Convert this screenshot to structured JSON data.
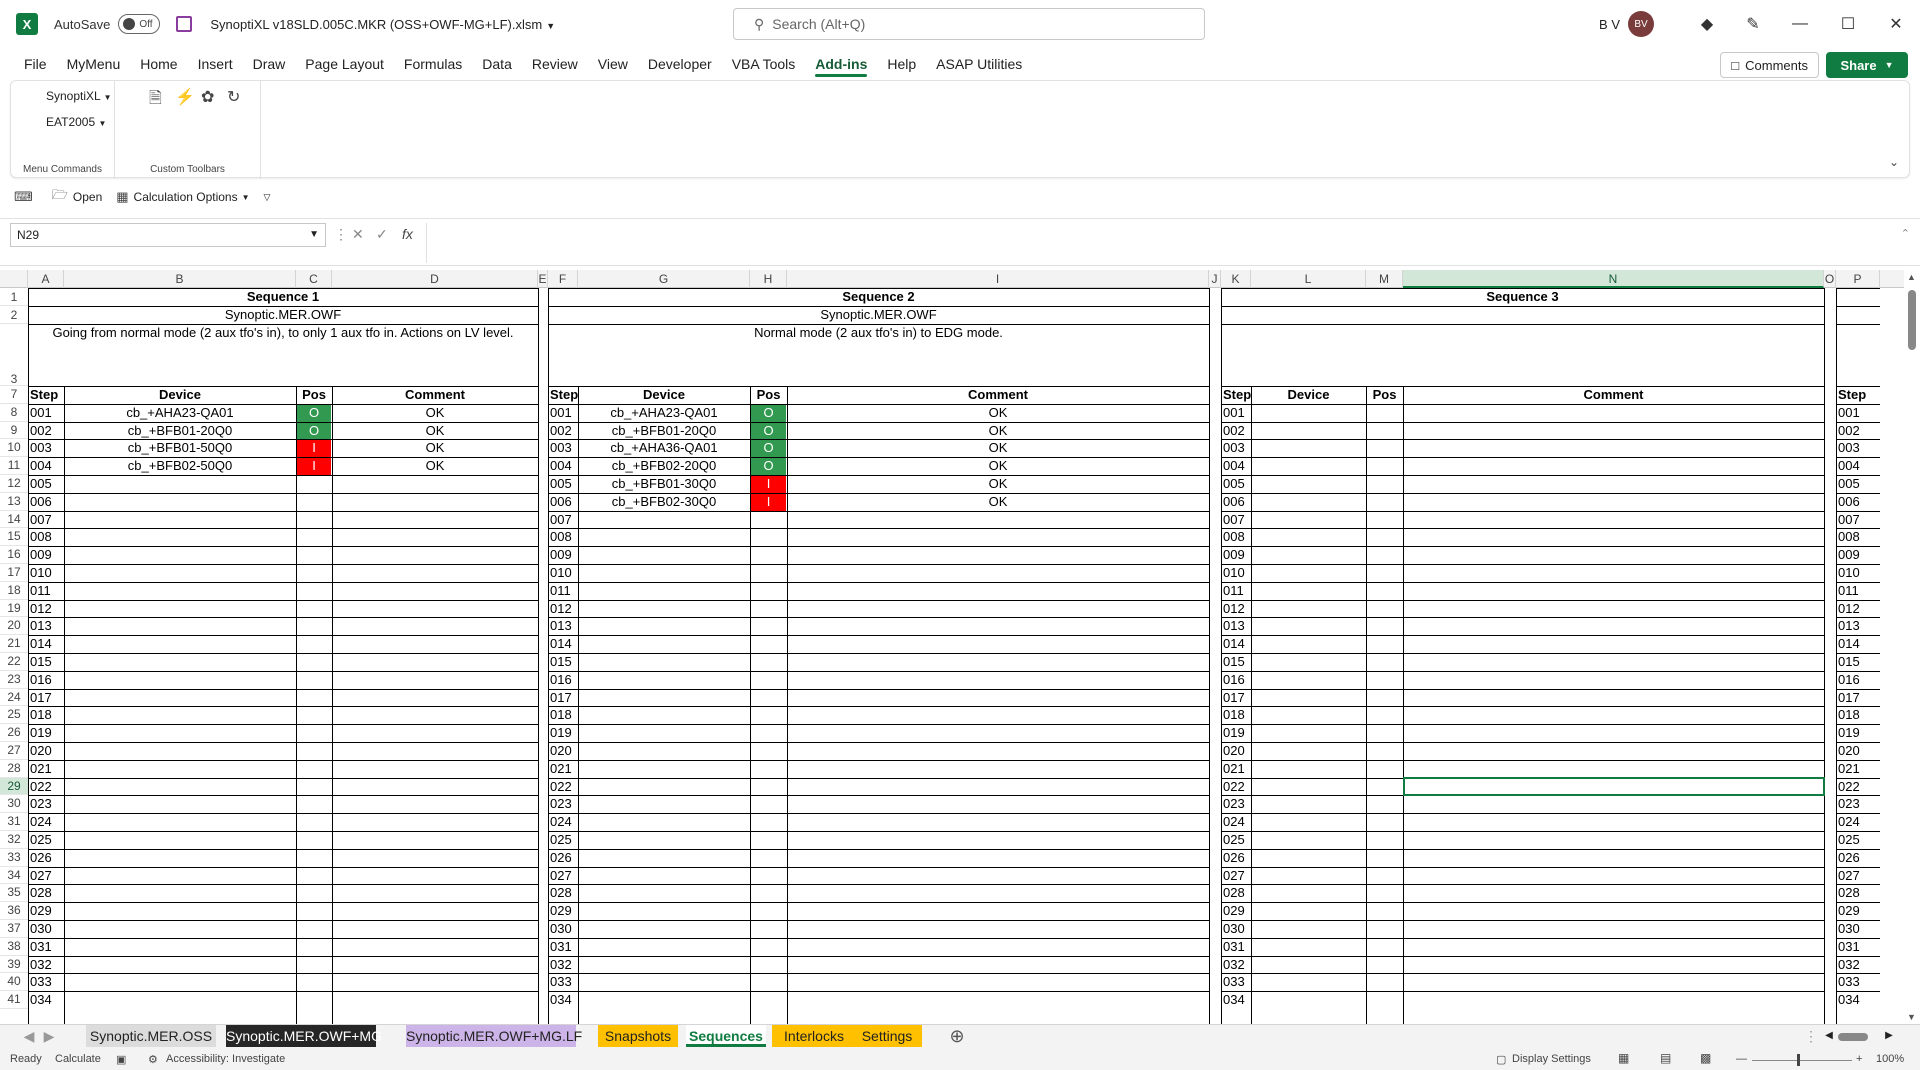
{
  "titlebar": {
    "autosave_label": "AutoSave",
    "toggle_label": "Off",
    "filename": "SynoptiXL v18SLD.005C.MKR (OSS+OWF-MG+LF).xlsm",
    "search_placeholder": "Search (Alt+Q)",
    "user_initials": "B V",
    "avatar_text": "BV"
  },
  "menu": {
    "tabs": [
      "File",
      "MyMenu",
      "Home",
      "Insert",
      "Draw",
      "Page Layout",
      "Formulas",
      "Data",
      "Review",
      "View",
      "Developer",
      "VBA Tools",
      "Add-ins",
      "Help",
      "ASAP Utilities"
    ],
    "active": "Add-ins",
    "comments_label": "Comments",
    "share_label": "Share"
  },
  "ribbon": {
    "dropdown1": "SynoptiXL",
    "dropdown2": "EAT2005",
    "group1_label": "Menu Commands",
    "group2_label": "Custom Toolbars"
  },
  "qat": {
    "open_label": "Open",
    "calc_label": "Calculation Options"
  },
  "formula_bar": {
    "name_box": "N29",
    "formula": ""
  },
  "columns": [
    "A",
    "B",
    "C",
    "D",
    "E",
    "F",
    "G",
    "H",
    "I",
    "J",
    "K",
    "L",
    "M",
    "N",
    "O",
    "P"
  ],
  "selected_column": "N",
  "rows": [
    "1",
    "2",
    "3",
    "7",
    "8",
    "9",
    "10",
    "11",
    "12",
    "13",
    "14",
    "15",
    "16",
    "17",
    "18",
    "19",
    "20",
    "21",
    "22",
    "23",
    "24",
    "25",
    "26",
    "27",
    "28",
    "29",
    "30",
    "31",
    "32",
    "33",
    "34",
    "35",
    "36",
    "37",
    "38",
    "39",
    "40",
    "41"
  ],
  "selected_row": "29",
  "sequences": [
    {
      "title": "Sequence 1",
      "subtitle": "Synoptic.MER.OWF",
      "description": "Going from normal mode (2 aux tfo's in), to only 1 aux tfo in. Actions on LV level.",
      "headers": {
        "step": "Step",
        "device": "Device",
        "pos": "Pos",
        "comment": "Comment"
      },
      "rows": [
        {
          "step": "001",
          "device": "cb_+AHA23-QA01",
          "pos": "O",
          "comment": "OK"
        },
        {
          "step": "002",
          "device": "cb_+BFB01-20Q0",
          "pos": "O",
          "comment": "OK"
        },
        {
          "step": "003",
          "device": "cb_+BFB01-50Q0",
          "pos": "I",
          "comment": "OK"
        },
        {
          "step": "004",
          "device": "cb_+BFB02-50Q0",
          "pos": "I",
          "comment": "OK"
        }
      ]
    },
    {
      "title": "Sequence 2",
      "subtitle": "Synoptic.MER.OWF",
      "description": "Normal mode (2 aux tfo's in) to EDG mode.",
      "headers": {
        "step": "Step",
        "device": "Device",
        "pos": "Pos",
        "comment": "Comment"
      },
      "rows": [
        {
          "step": "001",
          "device": "cb_+AHA23-QA01",
          "pos": "O",
          "comment": "OK"
        },
        {
          "step": "002",
          "device": "cb_+BFB01-20Q0",
          "pos": "O",
          "comment": "OK"
        },
        {
          "step": "003",
          "device": "cb_+AHA36-QA01",
          "pos": "O",
          "comment": "OK"
        },
        {
          "step": "004",
          "device": "cb_+BFB02-20Q0",
          "pos": "O",
          "comment": "OK"
        },
        {
          "step": "005",
          "device": "cb_+BFB01-30Q0",
          "pos": "I",
          "comment": "OK"
        },
        {
          "step": "006",
          "device": "cb_+BFB02-30Q0",
          "pos": "I",
          "comment": "OK"
        }
      ]
    },
    {
      "title": "Sequence 3",
      "subtitle": "",
      "description": "",
      "headers": {
        "step": "Step",
        "device": "Device",
        "pos": "Pos",
        "comment": "Comment"
      },
      "rows": []
    }
  ],
  "seq4_header": "Step",
  "step_numbers": [
    "001",
    "002",
    "003",
    "004",
    "005",
    "006",
    "007",
    "008",
    "009",
    "010",
    "011",
    "012",
    "013",
    "014",
    "015",
    "016",
    "017",
    "018",
    "019",
    "020",
    "021",
    "022",
    "023",
    "024",
    "025",
    "026",
    "027",
    "028",
    "029",
    "030",
    "031",
    "032",
    "033",
    "034"
  ],
  "pos_colors": {
    "O": "#319a50",
    "I": "#ff0000"
  },
  "sheet_tabs": [
    {
      "label": "Synoptic.MER.OSS",
      "bg": "#dcdcdc",
      "fg": "#222222"
    },
    {
      "label": "Synoptic.MER.OWF+MG",
      "bg": "#262626",
      "fg": "#ffffff"
    },
    {
      "label": "Synoptic.MER.OWF+MG.LF",
      "bg": "#cdb4e8",
      "fg": "#222222"
    },
    {
      "label": "Snapshots",
      "bg": "#ffc000",
      "fg": "#222222"
    },
    {
      "label": "Sequences",
      "bg": "#ffffff",
      "fg": "#107c41"
    },
    {
      "label": "Interlocks",
      "bg": "#ffc000",
      "fg": "#222222"
    },
    {
      "label": "Settings",
      "bg": "#ffc000",
      "fg": "#222222"
    }
  ],
  "active_sheet": "Sequences",
  "status": {
    "ready": "Ready",
    "calculate": "Calculate",
    "accessibility": "Accessibility: Investigate",
    "display_settings": "Display Settings",
    "zoom": "100%"
  }
}
